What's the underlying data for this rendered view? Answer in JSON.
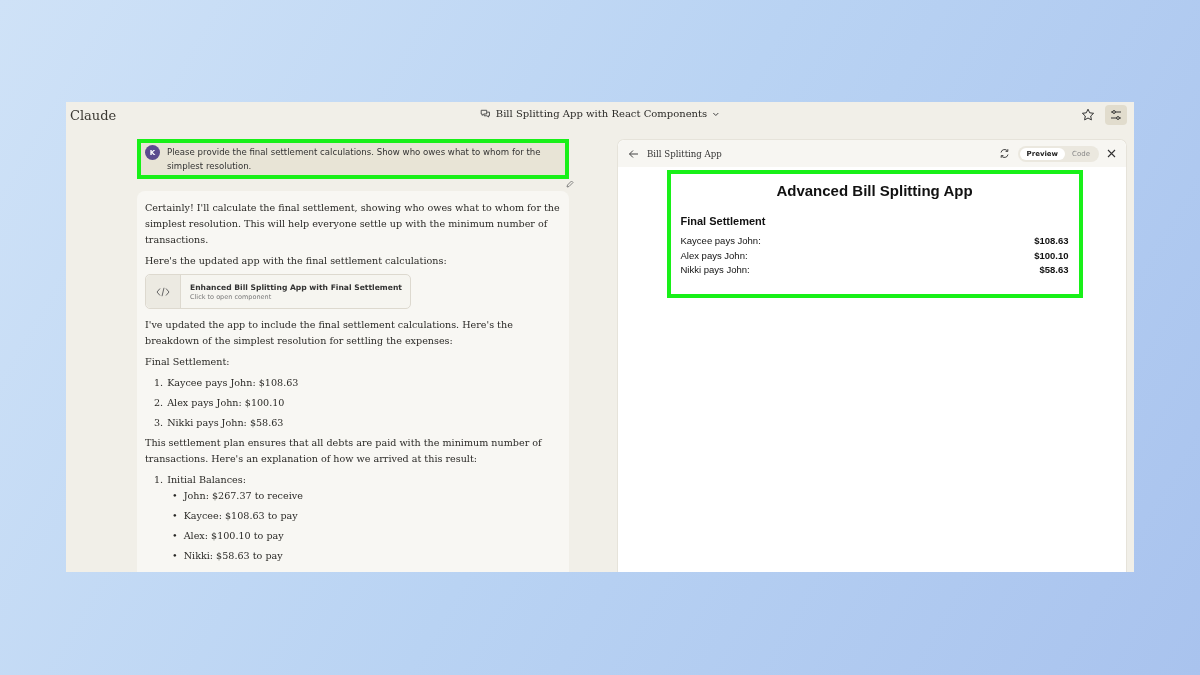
{
  "window": {
    "app_name": "Claude",
    "title": "Bill Splitting App with React Components"
  },
  "user_message": {
    "avatar": "K",
    "text": "Please provide the final settlement calculations. Show who owes what to whom for the simplest resolution."
  },
  "assistant_message": {
    "intro": "Certainly! I'll calculate the final settlement, showing who owes what to whom for the simplest resolution. This will help everyone settle up with the minimum number of transactions.",
    "lead": "Here's the updated app with the final settlement calculations:",
    "artifact": {
      "title": "Enhanced Bill Splitting App with Final Settlement",
      "subtitle": "Click to open component"
    },
    "summary": "I've updated the app to include the final settlement calculations. Here's the breakdown of the simplest resolution for settling the expenses:",
    "settlement_heading": "Final Settlement:",
    "settlement_list": [
      {
        "marker": "1.",
        "text": "Kaycee pays John: $108.63"
      },
      {
        "marker": "2.",
        "text": "Alex pays John: $100.10"
      },
      {
        "marker": "3.",
        "text": "Nikki pays John: $58.63"
      }
    ],
    "explanation": "This settlement plan ensures that all debts are paid with the minimum number of transactions. Here's an explanation of how we arrived at this result:",
    "steps": [
      {
        "marker": "1.",
        "text": "Initial Balances:",
        "children": [
          {
            "marker": "•",
            "text": "John: $267.37 to receive"
          },
          {
            "marker": "•",
            "text": "Kaycee: $108.63 to pay"
          },
          {
            "marker": "•",
            "text": "Alex: $100.10 to pay"
          },
          {
            "marker": "•",
            "text": "Nikki: $58.63 to pay"
          }
        ]
      }
    ]
  },
  "artifact_panel": {
    "title": "Bill Splitting App",
    "view_tabs": [
      {
        "label": "Preview",
        "selected": true
      },
      {
        "label": "Code",
        "selected": false
      }
    ],
    "preview": {
      "heading": "Advanced Bill Splitting App",
      "subheading": "Final Settlement",
      "rows": [
        {
          "label": "Kaycee pays John:",
          "amount": "$108.63"
        },
        {
          "label": "Alex pays John:",
          "amount": "$100.10"
        },
        {
          "label": "Nikki pays John:",
          "amount": "$58.63"
        }
      ]
    }
  }
}
